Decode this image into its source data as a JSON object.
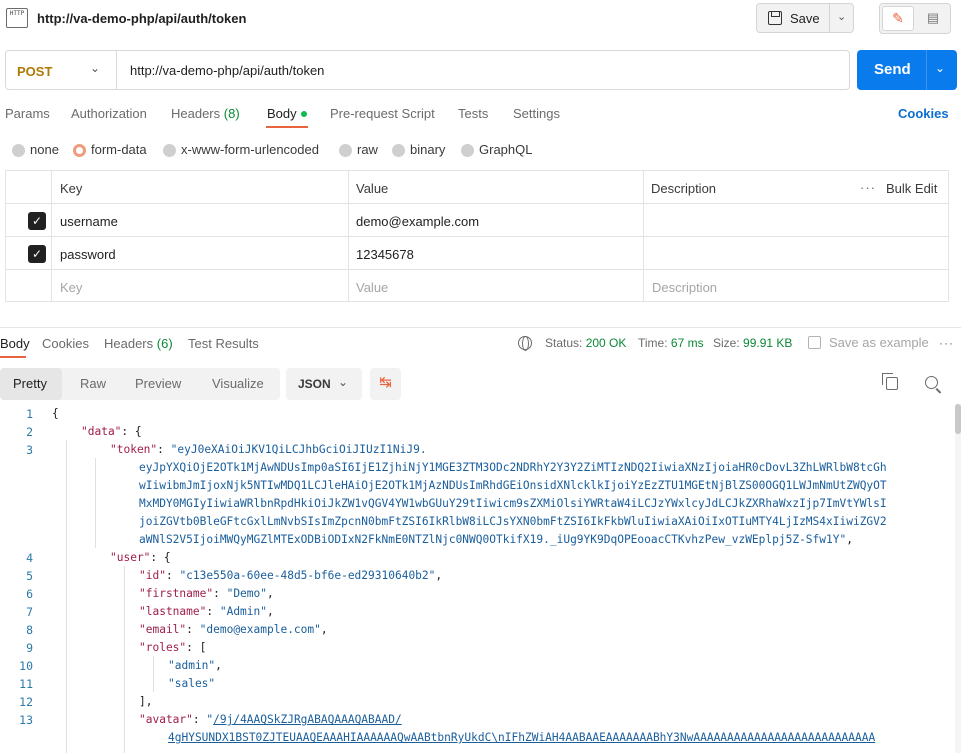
{
  "titlebar": {
    "icon_text": "HTTP",
    "url": "http://va-demo-php/api/auth/token",
    "save_label": "Save"
  },
  "request": {
    "method": "POST",
    "url": "http://va-demo-php/api/auth/token",
    "send_label": "Send"
  },
  "request_tabs": [
    {
      "label": "Params"
    },
    {
      "label": "Authorization"
    },
    {
      "label": "Headers",
      "count": "(8)"
    },
    {
      "label": "Body"
    },
    {
      "label": "Pre-request Script"
    },
    {
      "label": "Tests"
    },
    {
      "label": "Settings"
    }
  ],
  "cookies_label": "Cookies",
  "body_types": [
    "none",
    "form-data",
    "x-www-form-urlencoded",
    "raw",
    "binary",
    "GraphQL"
  ],
  "body_type_selected": "form-data",
  "params_table": {
    "headers": [
      "Key",
      "Value",
      "Description"
    ],
    "bulk_edit": "Bulk Edit",
    "rows": [
      {
        "checked": true,
        "key": "username",
        "value": "demo@example.com"
      },
      {
        "checked": true,
        "key": "password",
        "value": "12345678"
      }
    ],
    "placeholders": {
      "key": "Key",
      "value": "Value",
      "description": "Description"
    }
  },
  "response_tabs": [
    {
      "label": "Body"
    },
    {
      "label": "Cookies"
    },
    {
      "label": "Headers",
      "count": "(6)"
    },
    {
      "label": "Test Results"
    }
  ],
  "response_meta": {
    "status_label": "Status:",
    "status_value": "200 OK",
    "time_label": "Time:",
    "time_value": "67 ms",
    "size_label": "Size:",
    "size_value": "99.91 KB",
    "save_example": "Save as example"
  },
  "view_modes": [
    "Pretty",
    "Raw",
    "Preview",
    "Visualize"
  ],
  "view_selected": "Pretty",
  "format": "JSON",
  "code_lines": [
    {
      "n": "1",
      "html": "{"
    },
    {
      "n": "2",
      "html": "<span class=\"k\">\"data\"</span>: {"
    },
    {
      "n": "3",
      "html": "<span class=\"k\">\"token\"</span>: <span class=\"s\">\"eyJ0eXAiOiJKV1QiLCJhbGciOiJIUzI1NiJ9.</span>"
    },
    {
      "n": "",
      "html": "<span class=\"s\">eyJpYXQiOjE2OTk1MjAwNDUsImp0aSI6IjE1ZjhiNjY1MGE3ZTM3ODc2NDRhY2Y3Y2ZiMTIzNDQ2IiwiaXNzIjoiaHR0cDovL3ZhLWRlbW8tcGh</span>"
    },
    {
      "n": "",
      "html": "<span class=\"s\">wIiwibmJmIjoxNjk5NTIwMDQ1LCJleHAiOjE2OTk1MjAzNDUsImRhdGEiOnsidXNlcklkIjoiYzEzZTU1MGEtNjBlZS00OGQ1LWJmNmUtZWQyOT</span>"
    },
    {
      "n": "",
      "html": "<span class=\"s\">MxMDY0MGIyIiwiaWRlbnRpdHkiOiJkZW1vQGV4YW1wbGUuY29tIiwicm9sZXMiOlsiYWRtaW4iLCJzYWxlcyJdLCJkZXRhaWxzIjp7ImVtYWlsI</span>"
    },
    {
      "n": "",
      "html": "<span class=\"s\">joiZGVtb0BleGFtcGxlLmNvbSIsImZpcnN0bmFtZSI6IkRlbW8iLCJsYXN0bmFtZSI6IkFkbWluIiwiaXAiOiIxOTIuMTY4LjIzMS4xIiwiZGV2</span>"
    },
    {
      "n": "",
      "html": "<span class=\"s\">aWNlS2V5IjoiMWQyMGZlMTExODBiODIxN2FkNmE0NTZlNjc0NWQ0OTkifX19._iUg9YK9DqOPEooacCTKvhzPew_vzWEplpj5Z-Sfw1Y\"</span>,"
    },
    {
      "n": "4",
      "html": "<span class=\"k\">\"user\"</span>: {"
    },
    {
      "n": "5",
      "html": "<span class=\"k\">\"id\"</span>: <span class=\"s\">\"c13e550a-60ee-48d5-bf6e-ed29310640b2\"</span>,"
    },
    {
      "n": "6",
      "html": "<span class=\"k\">\"firstname\"</span>: <span class=\"s\">\"Demo\"</span>,"
    },
    {
      "n": "7",
      "html": "<span class=\"k\">\"lastname\"</span>: <span class=\"s\">\"Admin\"</span>,"
    },
    {
      "n": "8",
      "html": "<span class=\"k\">\"email\"</span>: <span class=\"s\">\"demo@example.com\"</span>,"
    },
    {
      "n": "9",
      "html": "<span class=\"k\">\"roles\"</span>: ["
    },
    {
      "n": "10",
      "html": "<span class=\"s\">\"admin\"</span>,"
    },
    {
      "n": "11",
      "html": "<span class=\"s\">\"sales\"</span>"
    },
    {
      "n": "12",
      "html": "],"
    },
    {
      "n": "13",
      "html": "<span class=\"k\">\"avatar\"</span>: <span class=\"s\">\"</span><span class=\"u\">/9j/4AAQSkZJRgABAQAAAQABAAD/</span>"
    },
    {
      "n": "",
      "html": "<span class=\"u\">4gHYSUNDX1BST0ZJTEUAAQEAAAHIAAAAAAQwAABtbnRyUkdC\\nIFhZWiAH4AABAAEAAAAAAABhY3NwAAAAAAAAAAAAAAAAAAAAAAAAAAA</span>"
    }
  ],
  "colors": {
    "accent": "#e8643f",
    "send": "#097bed",
    "status_ok": "#0a8a36",
    "method": "#ad7a03"
  }
}
